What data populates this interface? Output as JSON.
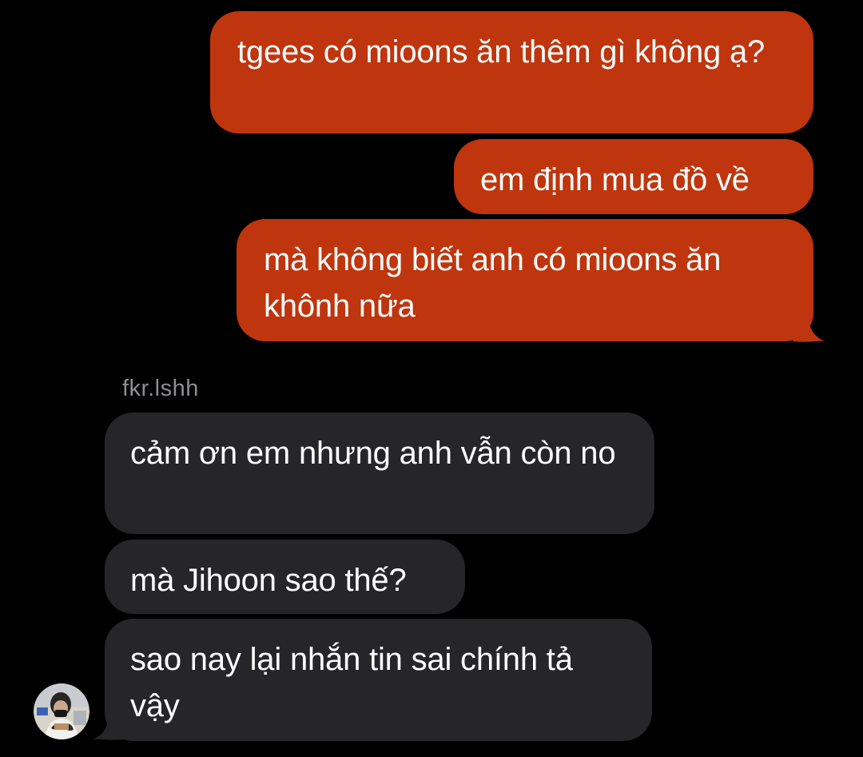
{
  "chat": {
    "sender_name": "fkr.lshh",
    "outgoing": [
      "tgees có mioons ăn thêm gì không ạ?",
      "em định mua đồ về",
      "mà không biết anh có mioons ăn khônh nữa"
    ],
    "incoming": [
      "cảm ơn em nhưng anh vẫn còn no",
      "mà Jihoon sao thế?",
      "sao nay lại nhắn tin sai chính tả vậy"
    ]
  },
  "colors": {
    "background": "#000000",
    "outgoing_bubble": "#bf350d",
    "incoming_bubble": "#262528",
    "text": "#ffffff",
    "sender_label": "#8e8e93"
  },
  "icons": {
    "avatar": "profile-photo"
  }
}
